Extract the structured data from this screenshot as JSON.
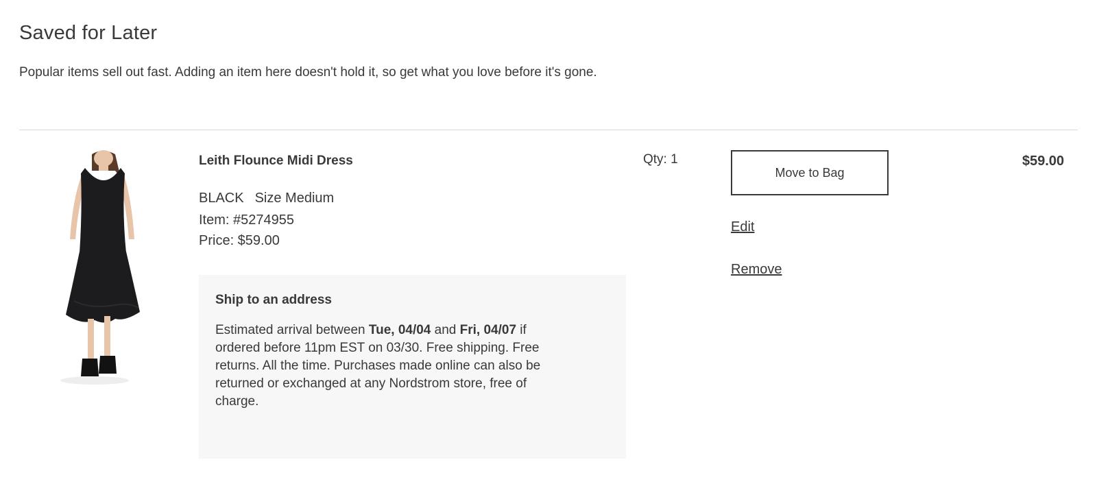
{
  "section": {
    "title": "Saved for Later",
    "subtitle": "Popular items sell out fast. Adding an item here doesn't hold it, so get what you love before it's gone."
  },
  "item": {
    "name": "Leith Flounce Midi Dress",
    "color": "BLACK",
    "size": "Size Medium",
    "item_number": "Item: #5274955",
    "price": "Price: $59.00",
    "image_icon": "dress-photo",
    "quantity": "Qty: 1",
    "line_total": "$59.00",
    "shipping": {
      "title": "Ship to an address",
      "text_1": "Estimated arrival between ",
      "date_start": "Tue, 04/04",
      "text_2": " and ",
      "date_end": "Fri, 04/07",
      "text_3": " if ordered before 11pm EST on 03/30. Free shipping. Free returns. All the time. Purchases made online can also be returned or exchanged at any Nordstrom store, free of charge."
    },
    "actions": {
      "move_label": "Move to Bag",
      "edit_label": "Edit",
      "remove_label": "Remove"
    }
  },
  "colors": {
    "text": "#393939",
    "divider": "#d9d9d9",
    "ship_box_bg": "#f7f7f7",
    "dress": "#1c1c1e"
  }
}
